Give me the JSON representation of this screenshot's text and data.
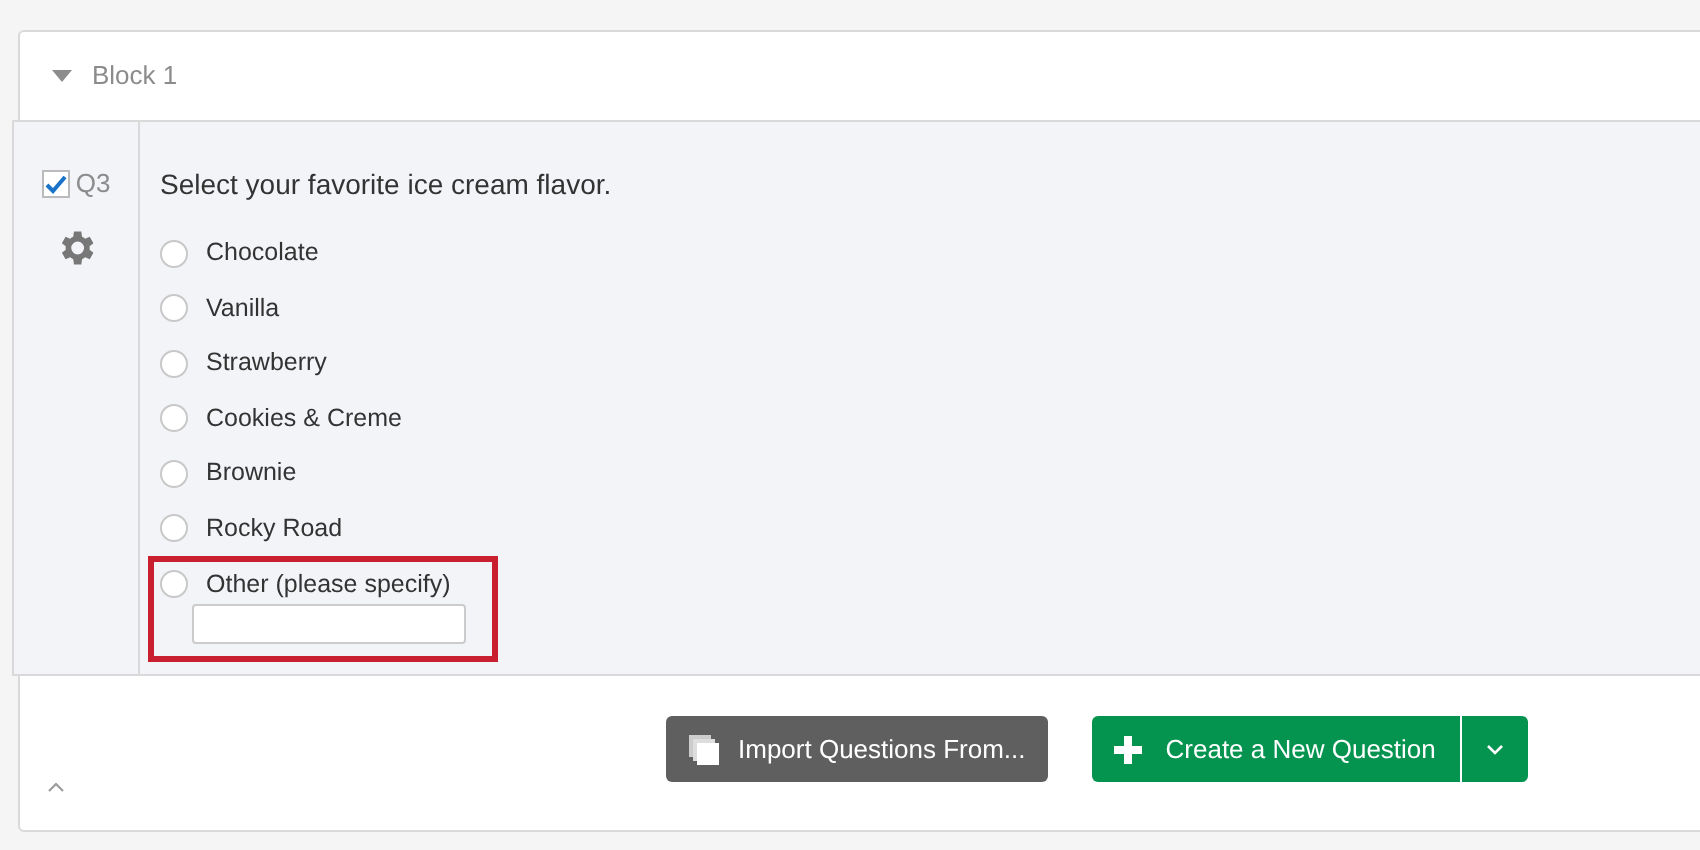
{
  "block": {
    "title": "Block 1",
    "expanded": true
  },
  "question": {
    "number": "Q3",
    "checked": true,
    "text": "Select your favorite ice cream flavor.",
    "choices": [
      {
        "label": "Chocolate",
        "selected": false,
        "kind": "plain"
      },
      {
        "label": "Vanilla",
        "selected": false,
        "kind": "plain"
      },
      {
        "label": "Strawberry",
        "selected": false,
        "kind": "plain"
      },
      {
        "label": "Cookies & Creme",
        "selected": false,
        "kind": "plain"
      },
      {
        "label": "Brownie",
        "selected": false,
        "kind": "plain"
      },
      {
        "label": "Rocky Road",
        "selected": false,
        "kind": "plain"
      },
      {
        "label": "Other (please specify)",
        "selected": false,
        "kind": "text_entry",
        "highlighted": true
      }
    ]
  },
  "buttons": {
    "import": "Import Questions From...",
    "create": "Create a New Question"
  }
}
